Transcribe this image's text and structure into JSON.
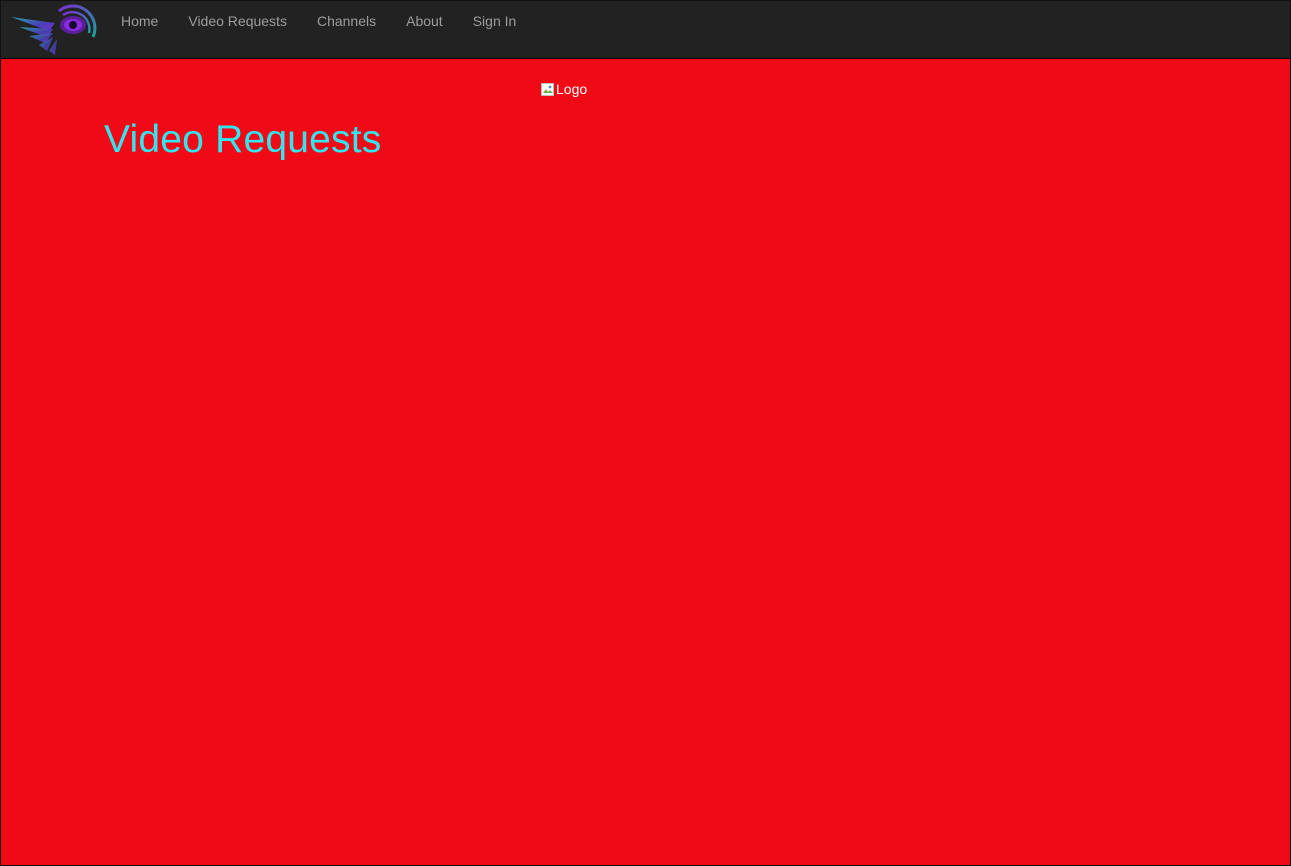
{
  "navbar": {
    "logo_icon": "winged-eye-logo-icon",
    "items": [
      {
        "label": "Home"
      },
      {
        "label": "Video Requests"
      },
      {
        "label": "Channels"
      },
      {
        "label": "About"
      },
      {
        "label": "Sign In"
      }
    ]
  },
  "main": {
    "logo_alt": "Logo",
    "logo_icon": "broken-image-icon",
    "title": "Video Requests"
  },
  "colors": {
    "navbar_bg": "#222222",
    "page_bg": "#f00a16",
    "title": "#33e5f0",
    "nav_text": "#9d9d9d"
  }
}
